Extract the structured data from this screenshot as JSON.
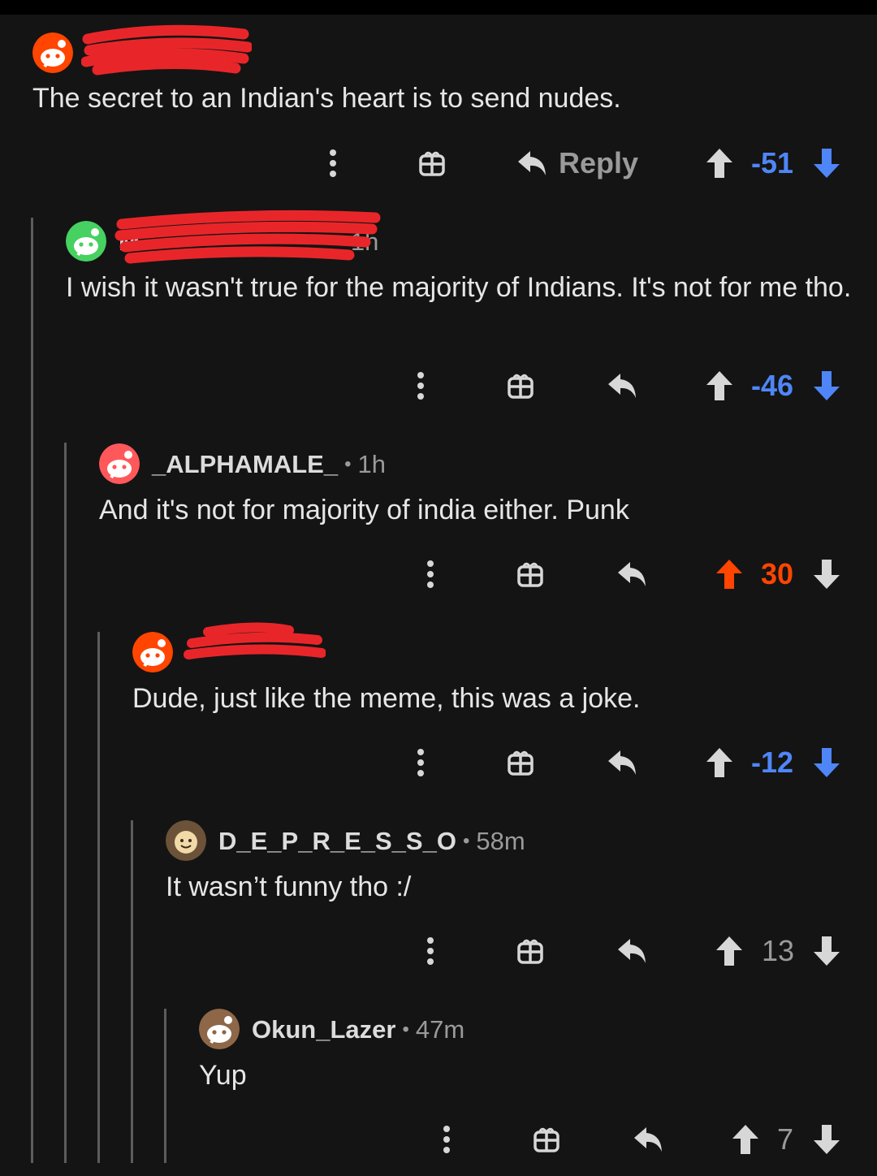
{
  "colors": {
    "background": "#141414",
    "upvote_active": "#ff4500",
    "downvote_active": "#4f86f7",
    "neutral": "#d7d7d7",
    "thread_line": "#5c5c5c"
  },
  "comments": [
    {
      "username": "",
      "age": "",
      "body": "The secret to an Indian's heart is to send nudes.",
      "score": "-51",
      "vote": "down",
      "reply_label": "Reply"
    },
    {
      "username": "M",
      "age": "1h",
      "body": "I wish it wasn't true for the majority of Indians. It's not for me tho.",
      "score": "-46",
      "vote": "down"
    },
    {
      "username": "_ALPHAMALE_",
      "age": "1h",
      "body": "And it's not for majority of india either. Punk",
      "score": "30",
      "vote": "up"
    },
    {
      "username": "",
      "age": "",
      "body": "Dude, just like the meme, this was a joke.",
      "score": "-12",
      "vote": "down"
    },
    {
      "username": "D_E_P_R_E_S_S_O",
      "age": "58m",
      "body": "It wasn’t funny tho :/",
      "score": "13",
      "vote": "none"
    },
    {
      "username": "Okun_Lazer",
      "age": "47m",
      "body": "Yup",
      "score": "7",
      "vote": "none"
    }
  ],
  "icons": {
    "more": "more-vertical-icon",
    "award": "gift-icon",
    "reply": "reply-arrow-icon",
    "upvote": "upvote-arrow-icon",
    "downvote": "downvote-arrow-icon"
  }
}
